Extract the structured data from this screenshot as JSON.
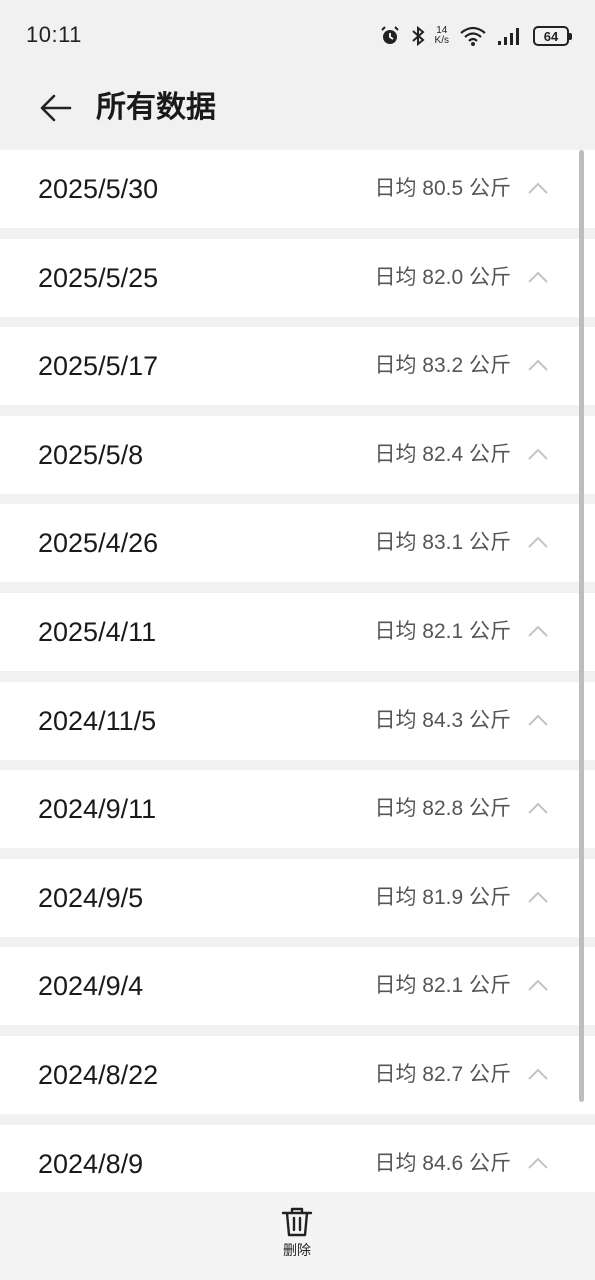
{
  "status_bar": {
    "time": "10:11",
    "net_speed_value": "14",
    "net_speed_unit": "K/s",
    "battery": "64"
  },
  "header": {
    "title": "所有数据"
  },
  "list": {
    "items": [
      {
        "date": "2025/5/30",
        "avg": "日均 80.5 公斤"
      },
      {
        "date": "2025/5/25",
        "avg": "日均 82.0 公斤"
      },
      {
        "date": "2025/5/17",
        "avg": "日均 83.2 公斤"
      },
      {
        "date": "2025/5/8",
        "avg": "日均 82.4 公斤"
      },
      {
        "date": "2025/4/26",
        "avg": "日均 83.1 公斤"
      },
      {
        "date": "2025/4/11",
        "avg": "日均 82.1 公斤"
      },
      {
        "date": "2024/11/5",
        "avg": "日均 84.3 公斤"
      },
      {
        "date": "2024/9/11",
        "avg": "日均 82.8 公斤"
      },
      {
        "date": "2024/9/5",
        "avg": "日均 81.9 公斤"
      },
      {
        "date": "2024/9/4",
        "avg": "日均 82.1 公斤"
      },
      {
        "date": "2024/8/22",
        "avg": "日均 82.7 公斤"
      },
      {
        "date": "2024/8/9",
        "avg": "日均 84.6 公斤"
      }
    ]
  },
  "bottom_bar": {
    "delete_label": "删除",
    "delete_icon": "trash-icon"
  }
}
